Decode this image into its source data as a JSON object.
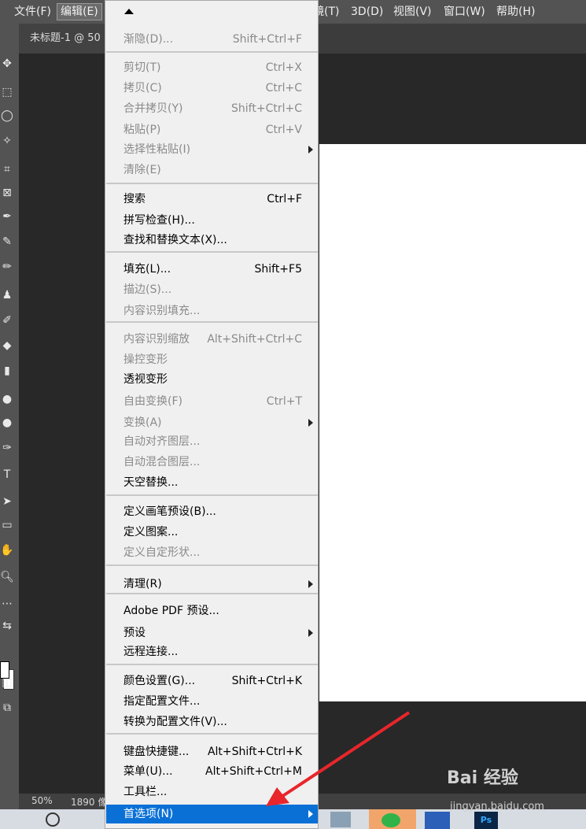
{
  "menubar": {
    "items": [
      "文件(F)",
      "编辑(E)",
      "镜(T)",
      "3D(D)",
      "视图(V)",
      "窗口(W)",
      "帮助(H)"
    ]
  },
  "document_tab": {
    "title": "未标题-1 @ 50"
  },
  "status": {
    "zoom": "50%",
    "info": "1890 像"
  },
  "edit_menu": {
    "items": [
      {
        "label": "渐隐(D)...",
        "shortcut": "Shift+Ctrl+F",
        "disabled": true
      },
      {
        "label": "剪切(T)",
        "shortcut": "Ctrl+X",
        "disabled": true
      },
      {
        "label": "拷贝(C)",
        "shortcut": "Ctrl+C",
        "disabled": true
      },
      {
        "label": "合并拷贝(Y)",
        "shortcut": "Shift+Ctrl+C",
        "disabled": true
      },
      {
        "label": "粘贴(P)",
        "shortcut": "Ctrl+V",
        "disabled": true
      },
      {
        "label": "选择性粘贴(I)",
        "shortcut": "",
        "disabled": true,
        "submenu": true
      },
      {
        "label": "清除(E)",
        "shortcut": "",
        "disabled": true
      },
      {
        "label": "搜索",
        "shortcut": "Ctrl+F",
        "disabled": false
      },
      {
        "label": "拼写检查(H)...",
        "shortcut": "",
        "disabled": false
      },
      {
        "label": "查找和替换文本(X)...",
        "shortcut": "",
        "disabled": false
      },
      {
        "label": "填充(L)...",
        "shortcut": "Shift+F5",
        "disabled": false
      },
      {
        "label": "描边(S)...",
        "shortcut": "",
        "disabled": true
      },
      {
        "label": "内容识别填充...",
        "shortcut": "",
        "disabled": true
      },
      {
        "label": "内容识别缩放",
        "shortcut": "Alt+Shift+Ctrl+C",
        "disabled": true
      },
      {
        "label": "操控变形",
        "shortcut": "",
        "disabled": true
      },
      {
        "label": "透视变形",
        "shortcut": "",
        "disabled": false
      },
      {
        "label": "自由变换(F)",
        "shortcut": "Ctrl+T",
        "disabled": true
      },
      {
        "label": "变换(A)",
        "shortcut": "",
        "disabled": true,
        "submenu": true
      },
      {
        "label": "自动对齐图层...",
        "shortcut": "",
        "disabled": true
      },
      {
        "label": "自动混合图层...",
        "shortcut": "",
        "disabled": true
      },
      {
        "label": "天空替换...",
        "shortcut": "",
        "disabled": false
      },
      {
        "label": "定义画笔预设(B)...",
        "shortcut": "",
        "disabled": false
      },
      {
        "label": "定义图案...",
        "shortcut": "",
        "disabled": false
      },
      {
        "label": "定义自定形状...",
        "shortcut": "",
        "disabled": true
      },
      {
        "label": "清理(R)",
        "shortcut": "",
        "disabled": false,
        "submenu": true
      },
      {
        "label": "Adobe PDF 预设...",
        "shortcut": "",
        "disabled": false
      },
      {
        "label": "预设",
        "shortcut": "",
        "disabled": false,
        "submenu": true
      },
      {
        "label": "远程连接...",
        "shortcut": "",
        "disabled": false
      },
      {
        "label": "颜色设置(G)...",
        "shortcut": "Shift+Ctrl+K",
        "disabled": false
      },
      {
        "label": "指定配置文件...",
        "shortcut": "",
        "disabled": false
      },
      {
        "label": "转换为配置文件(V)...",
        "shortcut": "",
        "disabled": false
      },
      {
        "label": "键盘快捷键...",
        "shortcut": "Alt+Shift+Ctrl+K",
        "disabled": false
      },
      {
        "label": "菜单(U)...",
        "shortcut": "Alt+Shift+Ctrl+M",
        "disabled": false
      },
      {
        "label": "工具栏...",
        "shortcut": "",
        "disabled": false
      },
      {
        "label": "首选项(N)",
        "shortcut": "",
        "disabled": false,
        "submenu": true,
        "highlighted": true
      }
    ]
  },
  "watermark": {
    "text": "Bai 经验",
    "url_text": "jingyan.baidu.com"
  },
  "colors": {
    "highlight": "#0a70d6",
    "annotation_arrow": "#e8262b"
  }
}
